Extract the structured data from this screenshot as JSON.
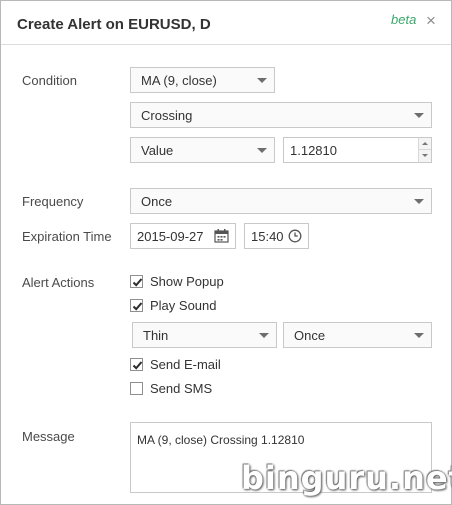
{
  "dialog": {
    "title": "Create Alert on EURUSD, D",
    "beta_label": "beta",
    "close_glyph": "×"
  },
  "condition": {
    "label": "Condition",
    "indicator": "MA (9, close)",
    "operator": "Crossing",
    "target_type": "Value",
    "value": "1.12810"
  },
  "frequency": {
    "label": "Frequency",
    "value": "Once"
  },
  "expiration": {
    "label": "Expiration Time",
    "date": "2015-09-27",
    "time": "15:40"
  },
  "alert_actions": {
    "label": "Alert Actions",
    "show_popup": {
      "label": "Show Popup",
      "checked": true
    },
    "play_sound": {
      "label": "Play Sound",
      "checked": true
    },
    "sound_name": "Thin",
    "sound_repeat": "Once",
    "send_email": {
      "label": "Send E-mail",
      "checked": true
    },
    "send_sms": {
      "label": "Send SMS",
      "checked": false
    }
  },
  "message": {
    "label": "Message",
    "value": "MA (9, close) Crossing 1.12810"
  },
  "watermark": "binguru.net",
  "icons": {
    "calendar": "calendar-icon",
    "clock": "clock-icon",
    "close": "close-icon",
    "checkmark": "checkmark-icon",
    "dropdown": "chevron-down-icon"
  },
  "colors": {
    "beta": "#3aa86b",
    "border": "#c9c9c9",
    "text": "#333333"
  }
}
